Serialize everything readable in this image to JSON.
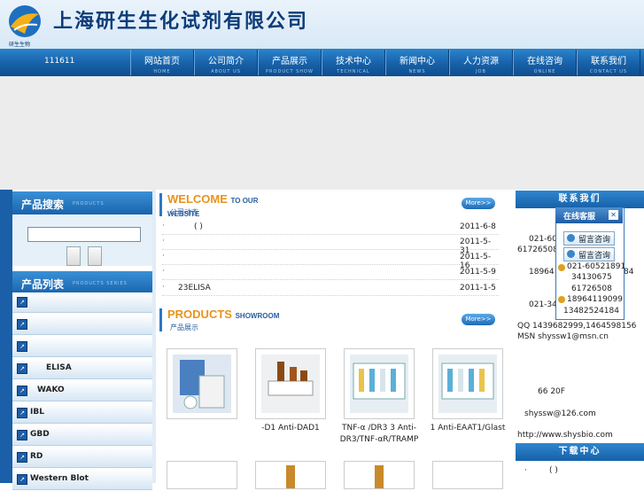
{
  "header": {
    "company_name": "上海研生生化试剂有限公司",
    "logo_text": "研生生物"
  },
  "nav": {
    "code": "111611",
    "items": [
      {
        "cn": "网站首页",
        "en": "HOME"
      },
      {
        "cn": "公司简介",
        "en": "ABOUT US"
      },
      {
        "cn": "产品展示",
        "en": "PRODUCT SHOW"
      },
      {
        "cn": "技术中心",
        "en": "TECHNICAL"
      },
      {
        "cn": "新闻中心",
        "en": "NEWS"
      },
      {
        "cn": "人力资源",
        "en": "JOB"
      },
      {
        "cn": "在线咨询",
        "en": "ONLINE"
      },
      {
        "cn": "联系我们",
        "en": "CONTACT US"
      }
    ]
  },
  "left": {
    "search_title": "产品搜索",
    "search_title_en": "PRODUCTS",
    "list_title": "产品列表",
    "list_title_en": "PRODUCTS SERIES",
    "categories": [
      "",
      "",
      "",
      "ELISA",
      "WAKO",
      "IBL",
      "GBD",
      "RD",
      "Western Blot"
    ]
  },
  "welcome": {
    "title": "WELCOME",
    "title_small": "TO OUR WEBSITE",
    "subtitle": "公司动态",
    "more": "More>>",
    "news": [
      {
        "title": "( )",
        "date": "2011-6-8"
      },
      {
        "title": "",
        "date": "2011-5-31"
      },
      {
        "title": "",
        "date": "2011-5-16"
      },
      {
        "title": "",
        "date": "2011-5-9"
      },
      {
        "title": "23ELISA",
        "date": "2011-1-5"
      }
    ]
  },
  "products": {
    "title": "PRODUCTS",
    "title_small": "SHOWROOM",
    "subtitle": "产品展示",
    "more": "More>>",
    "captions": [
      "",
      "-D1  Anti-DAD1",
      "TNF-α    /DR3    3 Anti-DR3/TNF-αR/TRAMP",
      "1   Anti-EAAT1/Glast"
    ]
  },
  "right": {
    "contact_title": "联系我们",
    "online_title": "在线客服",
    "buttons": [
      "留言咨询",
      "留言咨询"
    ],
    "phones": [
      "021-60521891",
      "34130675",
      "61726508",
      "18964119099",
      "13482524184"
    ],
    "contact_lines": [
      "021-60",
      "61726508",
      "18964",
      "84",
      "021-34",
      "QQ 1439682999,1464598156",
      "MSN shyssw1@msn.cn",
      "66 20F",
      "shyssw@126.com",
      "http://www.shysbio.com"
    ],
    "download_title": "下载中心",
    "download_item": "( )"
  }
}
